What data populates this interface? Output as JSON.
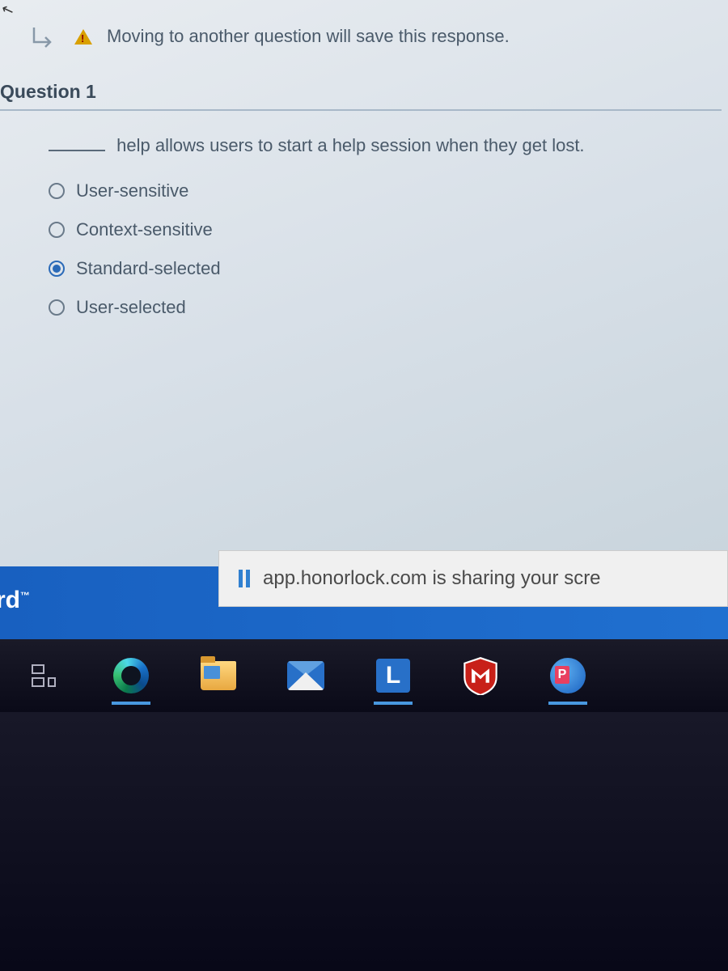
{
  "warning": {
    "message": "Moving to another question will save this response."
  },
  "question": {
    "header": "Question 1",
    "blank_prefix": "",
    "text": "help allows users to start a help session when they get lost.",
    "options": [
      {
        "label": "User-sensitive",
        "selected": false
      },
      {
        "label": "Context-sensitive",
        "selected": false
      },
      {
        "label": "Standard-selected",
        "selected": true
      },
      {
        "label": "User-selected",
        "selected": false
      }
    ]
  },
  "footer": {
    "brand_fragment": "rd",
    "brand_tm": "™"
  },
  "share_notification": {
    "text": "app.honorlock.com is sharing your scre"
  },
  "taskbar": {
    "icons": [
      {
        "name": "task-view-icon"
      },
      {
        "name": "edge-browser-icon"
      },
      {
        "name": "file-explorer-icon"
      },
      {
        "name": "mail-icon"
      },
      {
        "name": "lockdown-browser-icon",
        "letter": "L"
      },
      {
        "name": "mcafee-icon"
      },
      {
        "name": "pearson-icon"
      }
    ]
  }
}
